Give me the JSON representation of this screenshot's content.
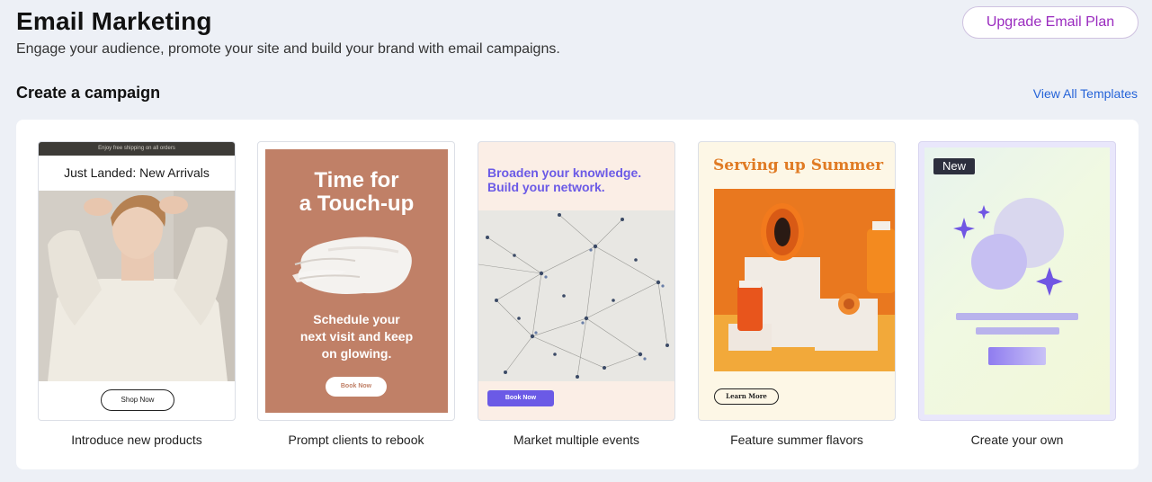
{
  "header": {
    "title": "Email Marketing",
    "subtitle": "Engage your audience, promote your site and build your brand with email campaigns.",
    "upgrade_label": "Upgrade Email Plan"
  },
  "section": {
    "title": "Create a campaign",
    "view_all_label": "View All Templates"
  },
  "templates": [
    {
      "caption": "Introduce new products",
      "topbar": "Enjoy free shipping on all orders",
      "headline": "Just Landed: New Arrivals",
      "button": "Shop Now"
    },
    {
      "caption": "Prompt clients to rebook",
      "headline_line1": "Time for",
      "headline_line2": "a Touch-up",
      "body_line1": "Schedule your",
      "body_line2": "next visit and keep",
      "body_line3": "on glowing.",
      "button": "Book Now"
    },
    {
      "caption": "Market multiple events",
      "headline_line1": "Broaden your knowledge.",
      "headline_line2": "Build your network.",
      "button": "Book Now"
    },
    {
      "caption": "Feature summer flavors",
      "headline": "Serving up Summer",
      "button": "Learn More"
    },
    {
      "caption": "Create your own",
      "badge": "New"
    }
  ],
  "colors": {
    "background": "#edf0f6",
    "upgrade_text": "#9a2bbf",
    "link": "#2563d8",
    "rebook_bg": "#c08067",
    "events_accent": "#6b5ae6",
    "summer_accent": "#e07b24"
  }
}
